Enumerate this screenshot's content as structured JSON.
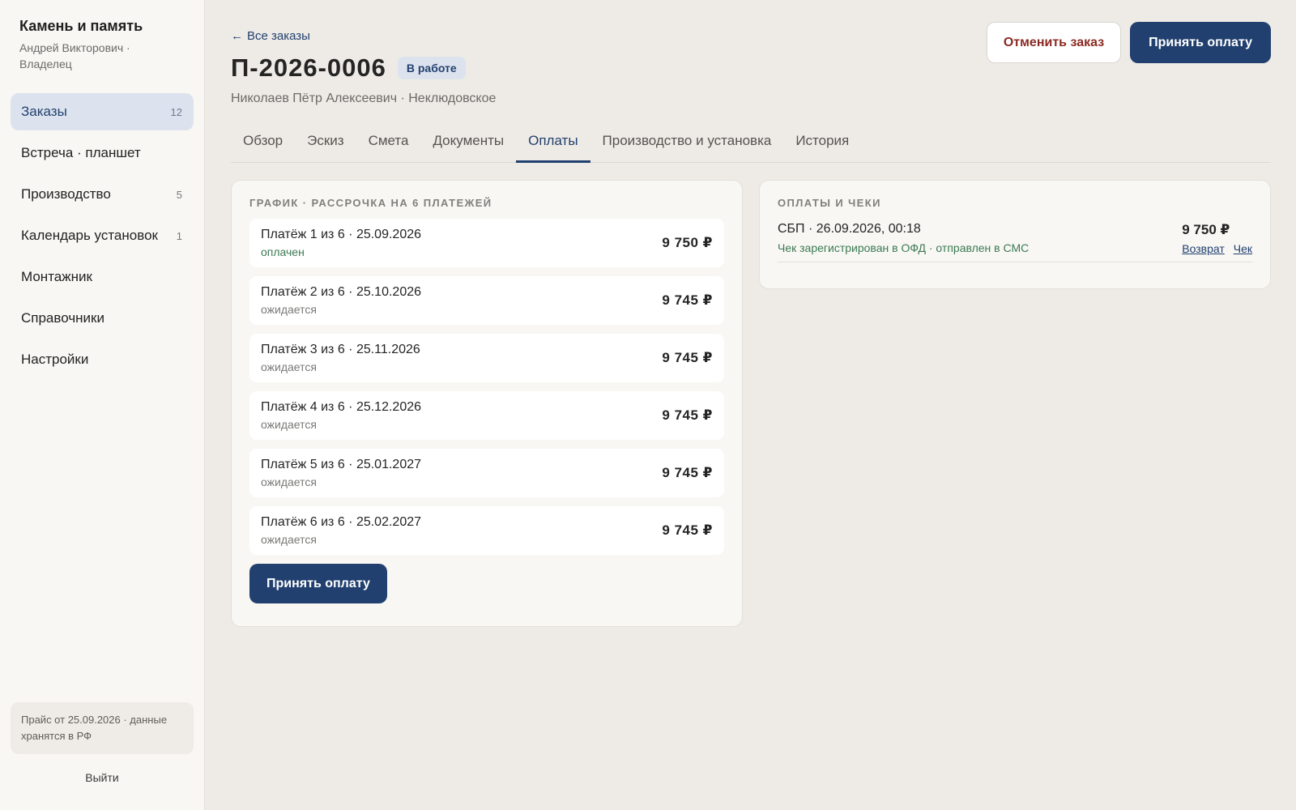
{
  "sidebar": {
    "brand_title": "Камень и память",
    "brand_sub": "Андрей Викторович · Владелец",
    "items": [
      {
        "label": "Заказы",
        "count": "12"
      },
      {
        "label": "Встреча · планшет",
        "count": ""
      },
      {
        "label": "Производство",
        "count": "5"
      },
      {
        "label": "Календарь установок",
        "count": "1"
      },
      {
        "label": "Монтажник",
        "count": ""
      },
      {
        "label": "Справочники",
        "count": ""
      },
      {
        "label": "Настройки",
        "count": ""
      }
    ],
    "footer_note": "Прайс от 25.09.2026 · данные хранятся в РФ",
    "logout": "Выйти"
  },
  "header": {
    "back_link": "Все заказы",
    "back_icon": "←",
    "order_number": "П-2026-0006",
    "status": "В работе",
    "client": "Николаев Пётр Алексеевич · Неклюдовское",
    "cancel_label": "Отменить заказ",
    "accept_label": "Принять оплату"
  },
  "tabs": [
    "Обзор",
    "Эскиз",
    "Смета",
    "Документы",
    "Оплаты",
    "Производство и установка",
    "История"
  ],
  "active_tab": "Оплаты",
  "schedule": {
    "title": "ГРАФИК · РАССРОЧКА НА 6 ПЛАТЕЖЕЙ",
    "payments": [
      {
        "label": "Платёж 1 из 6 · 25.09.2026",
        "status": "оплачен",
        "amount": "9 750 ₽"
      },
      {
        "label": "Платёж 2 из 6 · 25.10.2026",
        "status": "ожидается",
        "amount": "9 745 ₽"
      },
      {
        "label": "Платёж 3 из 6 · 25.11.2026",
        "status": "ожидается",
        "amount": "9 745 ₽"
      },
      {
        "label": "Платёж 4 из 6 · 25.12.2026",
        "status": "ожидается",
        "amount": "9 745 ₽"
      },
      {
        "label": "Платёж 5 из 6 · 25.01.2027",
        "status": "ожидается",
        "amount": "9 745 ₽"
      },
      {
        "label": "Платёж 6 из 6 · 25.02.2027",
        "status": "ожидается",
        "amount": "9 745 ₽"
      }
    ],
    "accept_label": "Принять оплату"
  },
  "receipts": {
    "title": "ОПЛАТЫ И ЧЕКИ",
    "items": [
      {
        "title": "СБП · 26.09.2026, 00:18",
        "note": "Чек зарегистрирован в ОФД · отправлен в СМС",
        "amount": "9 750 ₽",
        "refund_label": "Возврат",
        "check_label": "Чек"
      }
    ]
  },
  "colors": {
    "accent": "#22406f",
    "danger": "#8b2a22",
    "success": "#3c7a52",
    "background": "#eeebe6"
  }
}
